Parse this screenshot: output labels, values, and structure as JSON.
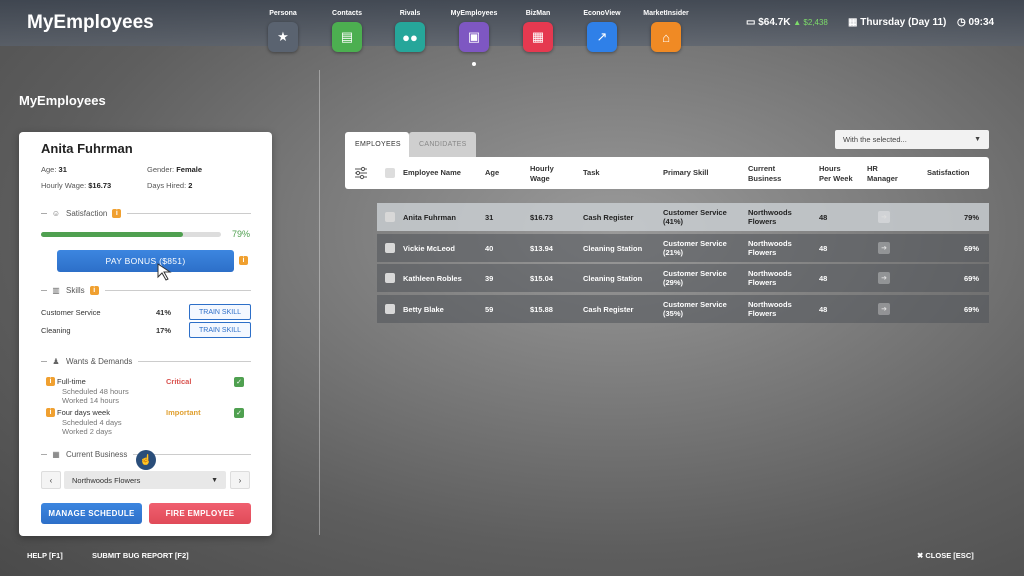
{
  "app": {
    "title": "MyEmployees",
    "page_title": "MyEmployees"
  },
  "nav": [
    {
      "label": "Persona",
      "icon": "persona-icon",
      "color": "#5a6370"
    },
    {
      "label": "Contacts",
      "icon": "chat-icon",
      "color": "#4caf50"
    },
    {
      "label": "Rivals",
      "icon": "people-icon",
      "color": "#26a69a"
    },
    {
      "label": "MyEmployees",
      "icon": "id-card-icon",
      "color": "#7e57c2"
    },
    {
      "label": "BizMan",
      "icon": "store-icon",
      "color": "#e53950"
    },
    {
      "label": "EconoView",
      "icon": "trend-icon",
      "color": "#2f80e8"
    },
    {
      "label": "MarketInsider",
      "icon": "market-icon",
      "color": "#f08a24"
    }
  ],
  "status": {
    "money": "$64.7K",
    "money_delta": "▲ $2,438",
    "date": "Thursday (Day 11)",
    "time": "09:34"
  },
  "employee": {
    "name": "Anita Fuhrman",
    "age_label": "Age:",
    "age": "31",
    "gender_label": "Gender:",
    "gender": "Female",
    "wage_label": "Hourly Wage:",
    "wage": "$16.73",
    "days_label": "Days Hired:",
    "days": "2",
    "satisfaction_label": "Satisfaction",
    "satisfaction_pct": "79%",
    "satisfaction_value": 0.79,
    "pay_bonus": "PAY BONUS ($851)",
    "skills_label": "Skills",
    "skills": [
      {
        "name": "Customer Service",
        "pct": "41%",
        "button": "TRAIN SKILL"
      },
      {
        "name": "Cleaning",
        "pct": "17%",
        "button": "TRAIN SKILL"
      }
    ],
    "wants_label": "Wants & Demands",
    "wants": [
      {
        "title": "Full-time",
        "level": "Critical",
        "level_color": "#d9534f",
        "sub1": "Scheduled 48 hours",
        "sub2": "Worked 14 hours"
      },
      {
        "title": "Four days week",
        "level": "Important",
        "level_color": "#e0a030",
        "sub1": "Scheduled 4 days",
        "sub2": "Worked 2 days"
      }
    ],
    "business_label": "Current Business",
    "business": "Northwoods Flowers",
    "manage_schedule": "MANAGE SCHEDULE",
    "fire": "FIRE EMPLOYEE"
  },
  "table": {
    "tabs": [
      "EMPLOYEES",
      "CANDIDATES"
    ],
    "with_selected": "With the selected...",
    "headers": {
      "name": "Employee Name",
      "age": "Age",
      "wage1": "Hourly",
      "wage2": "Wage",
      "task": "Task",
      "skill": "Primary Skill",
      "biz1": "Current",
      "biz2": "Business",
      "hours1": "Hours",
      "hours2": "Per Week",
      "hr1": "HR",
      "hr2": "Manager",
      "sat": "Satisfaction"
    },
    "rows": [
      {
        "name": "Anita Fuhrman",
        "age": "31",
        "wage": "$16.73",
        "task": "Cash Register",
        "skill1": "Customer Service",
        "skill2": "(41%)",
        "biz1": "Northwoods",
        "biz2": "Flowers",
        "hours": "48",
        "sat": "79%"
      },
      {
        "name": "Vickie McLeod",
        "age": "40",
        "wage": "$13.94",
        "task": "Cleaning Station",
        "skill1": "Customer Service",
        "skill2": "(21%)",
        "biz1": "Northwoods",
        "biz2": "Flowers",
        "hours": "48",
        "sat": "69%"
      },
      {
        "name": "Kathleen Robles",
        "age": "39",
        "wage": "$15.04",
        "task": "Cleaning Station",
        "skill1": "Customer Service",
        "skill2": "(29%)",
        "biz1": "Northwoods",
        "biz2": "Flowers",
        "hours": "48",
        "sat": "69%"
      },
      {
        "name": "Betty Blake",
        "age": "59",
        "wage": "$15.88",
        "task": "Cash Register",
        "skill1": "Customer Service",
        "skill2": "(35%)",
        "biz1": "Northwoods",
        "biz2": "Flowers",
        "hours": "48",
        "sat": "69%"
      }
    ]
  },
  "footer": {
    "help": "HELP [F1]",
    "bug": "SUBMIT BUG REPORT [F2]",
    "close": "CLOSE [ESC]"
  }
}
